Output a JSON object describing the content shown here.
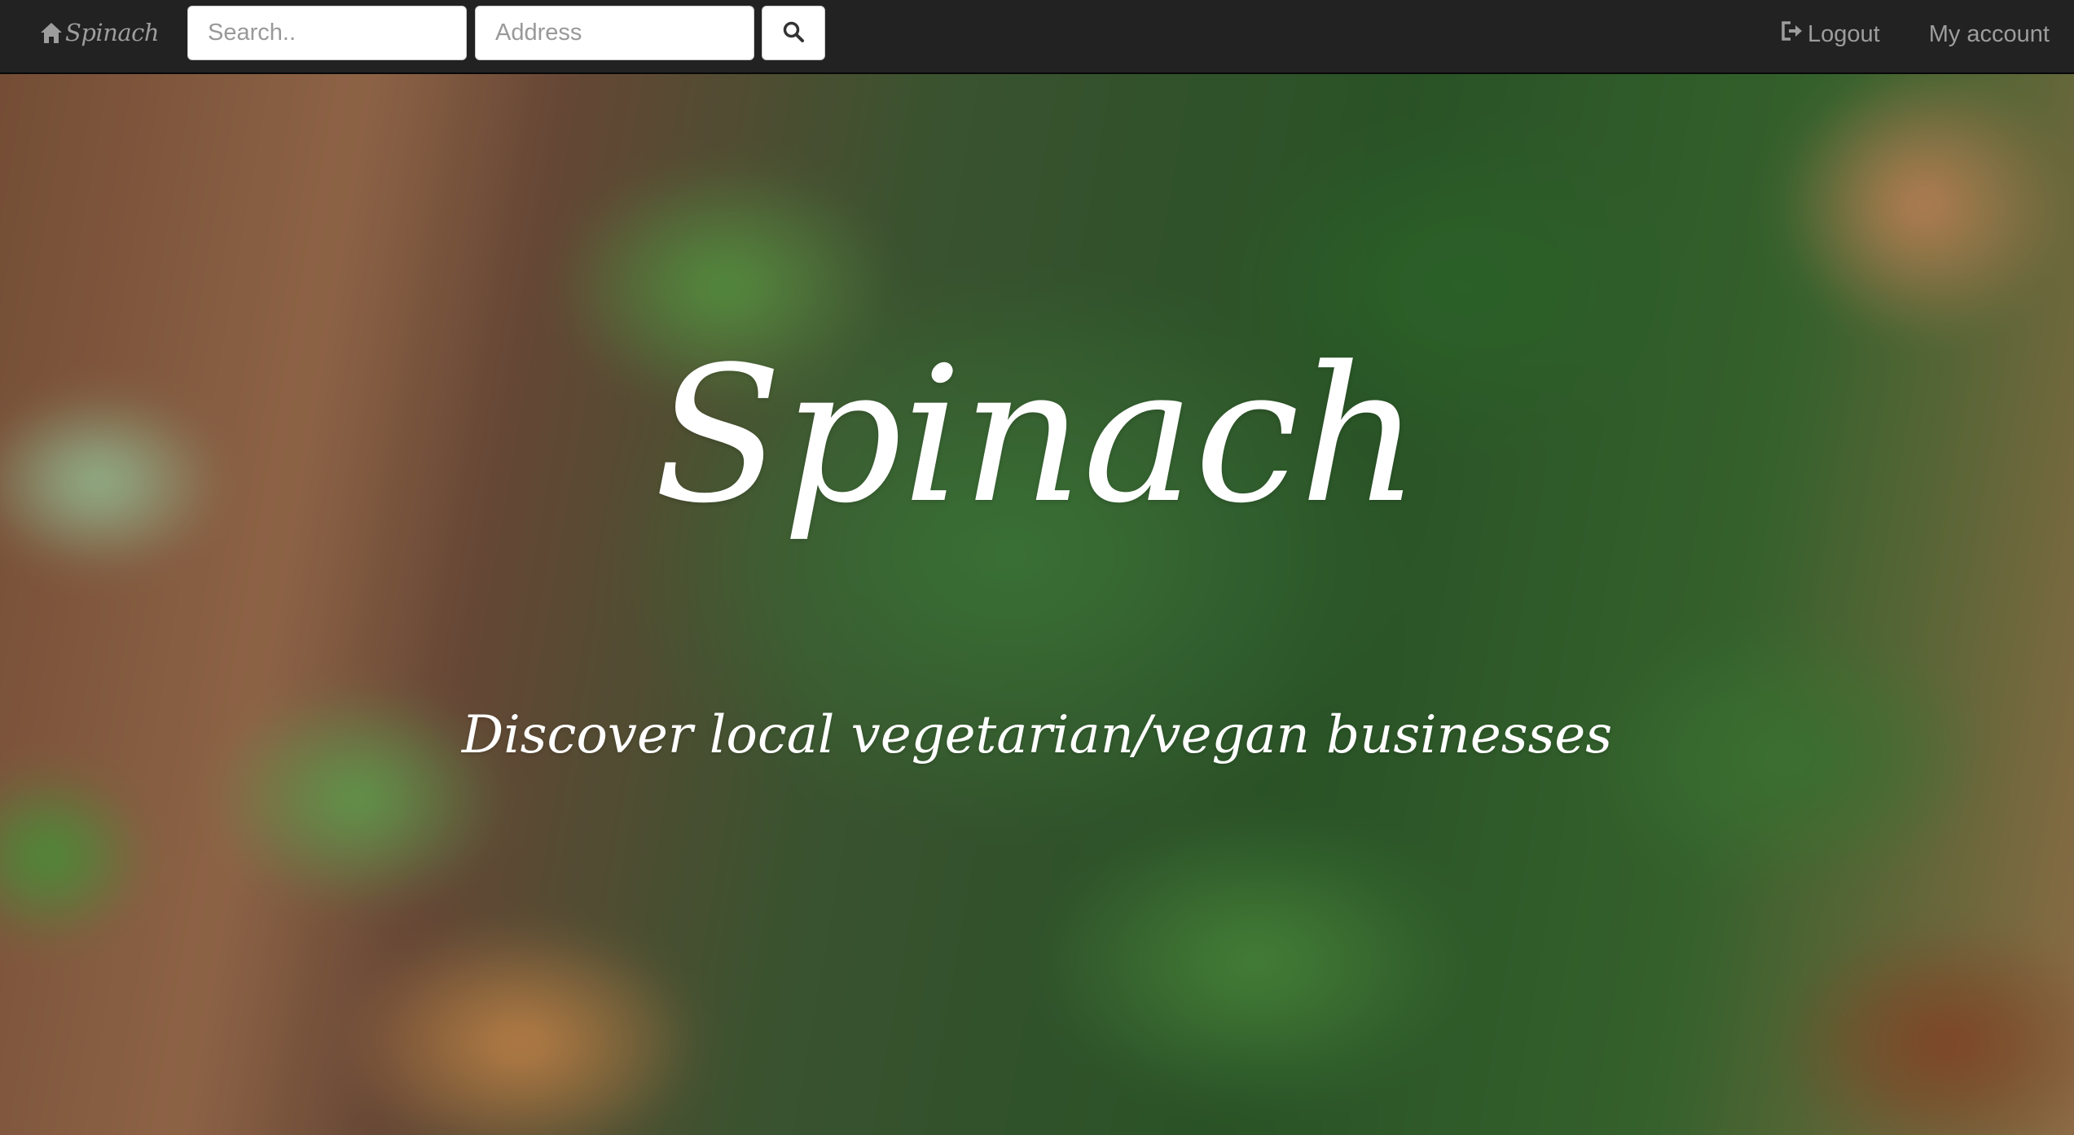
{
  "navbar": {
    "brand": {
      "label": "Spinach",
      "icon": "home-icon"
    },
    "search": {
      "placeholder": "Search..",
      "value": ""
    },
    "address": {
      "placeholder": "Address",
      "value": ""
    },
    "search_button": {
      "icon": "search-icon"
    },
    "logout": {
      "label": "Logout",
      "icon": "logout-icon"
    },
    "account": {
      "label": "My account"
    }
  },
  "hero": {
    "title": "Spinach",
    "subtitle": "Discover local vegetarian/vegan businesses"
  },
  "colors": {
    "navbar_bg": "#222222",
    "navbar_text": "#9d9d9d",
    "hero_text": "#ffffff"
  }
}
